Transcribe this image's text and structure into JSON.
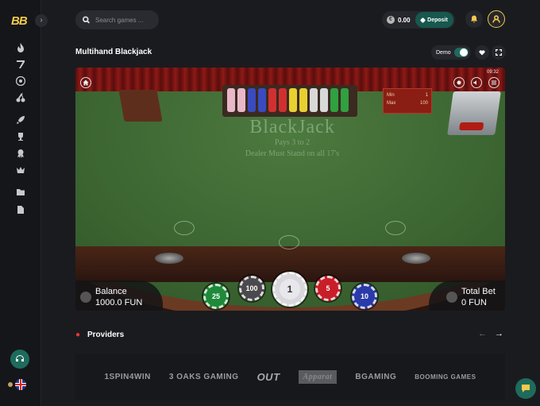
{
  "brand": {
    "logo": "BB"
  },
  "sidebar": {
    "items": [
      {
        "icon": "fire-icon"
      },
      {
        "icon": "slot-seven-icon"
      },
      {
        "icon": "roulette-icon"
      },
      {
        "icon": "cherry-icon"
      },
      {
        "icon": "rocket-icon"
      },
      {
        "icon": "trophy-icon"
      },
      {
        "icon": "award-icon"
      },
      {
        "icon": "crown-icon"
      },
      {
        "icon": "folder-icon"
      },
      {
        "icon": "document-icon"
      }
    ]
  },
  "search": {
    "placeholder": "Search games ..."
  },
  "header": {
    "balance": "0.00",
    "currency_symbol": "€",
    "deposit_label": "Deposit"
  },
  "game": {
    "title": "Multihand Blackjack",
    "demo_label": "Demo",
    "demo_enabled": true,
    "clock": "09:32",
    "table_logo": {
      "title": "BlackJack",
      "pays": "Pays 3 to 2",
      "rule": "Dealer Must Stand on all 17's"
    },
    "limits": {
      "min_label": "Min",
      "min_value": "1",
      "max_label": "Max",
      "max_value": "100"
    },
    "balance_label": "Balance",
    "balance_value": "1000.0 FUN",
    "total_bet_label": "Total Bet",
    "total_bet_value": "0 FUN",
    "chips": [
      "25",
      "100",
      "1",
      "5",
      "10"
    ]
  },
  "providers": {
    "title": "Providers",
    "items": [
      "1SPIN4WIN",
      "3 OAKS GAMING",
      "OUT",
      "Apparat",
      "BGAMING",
      "BOOMING GAMES"
    ]
  },
  "colors": {
    "accent_green": "#1e6b5c",
    "accent_gold": "#f2c94c",
    "background": "#1a1b1f"
  }
}
